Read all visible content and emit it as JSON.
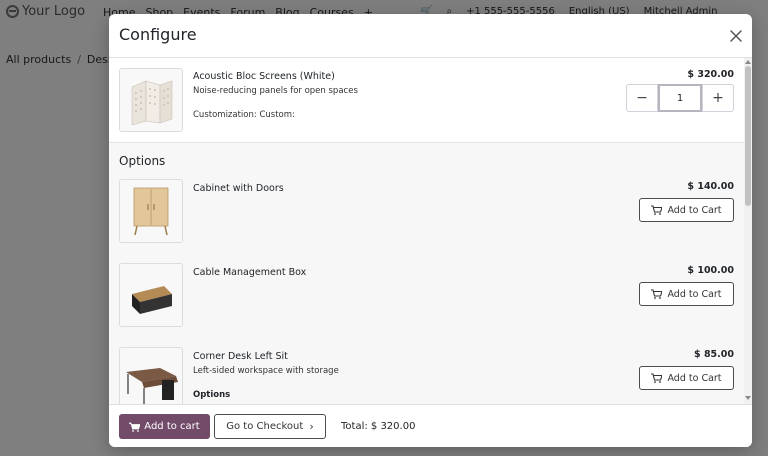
{
  "background": {
    "logo": "Your Logo",
    "nav": [
      "Home",
      "Shop",
      "Events",
      "Forum",
      "Blog",
      "Courses",
      "+"
    ],
    "phone": "+1 555-555-5556",
    "language": "English (US)",
    "user": "Mitchell Admin",
    "breadcrumb": [
      "All products",
      "Desks"
    ]
  },
  "modal": {
    "title": "Configure",
    "main_product": {
      "name": "Acoustic Bloc Screens (White)",
      "description": "Noise-reducing panels for open spaces",
      "customization": "Customization: Custom:",
      "price": "$ 320.00",
      "quantity": "1"
    },
    "options_title": "Options",
    "options": [
      {
        "name": "Cabinet with Doors",
        "price": "$ 140.00",
        "button": "Add to Cart"
      },
      {
        "name": "Cable Management Box",
        "price": "$ 100.00",
        "button": "Add to Cart"
      },
      {
        "name": "Corner Desk Left Sit",
        "description": "Left-sided workspace with storage",
        "sub_label": "Options",
        "price": "$ 85.00",
        "button": "Add to Cart"
      }
    ],
    "footer": {
      "add_to_cart": "Add to cart",
      "checkout": "Go to Checkout",
      "total": "Total: $ 320.00"
    }
  },
  "colors": {
    "primary": "#714b67",
    "backdrop": "#000000"
  },
  "icons": [
    "cart-icon",
    "close-icon",
    "chevron-right-icon",
    "minus-icon",
    "plus-icon",
    "search-icon",
    "phone-icon",
    "caret-down-icon"
  ]
}
